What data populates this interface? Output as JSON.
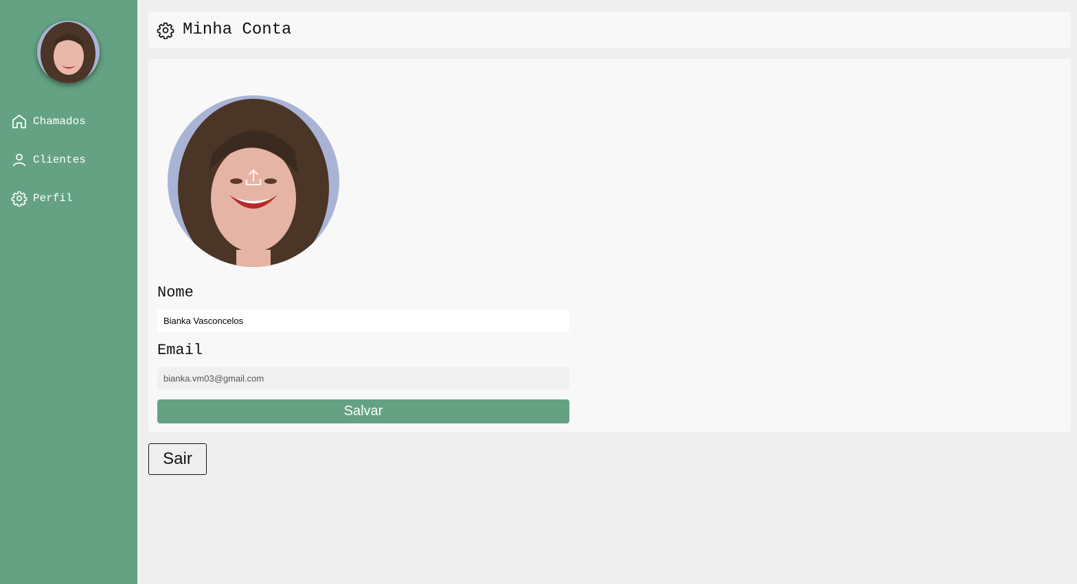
{
  "sidebar": {
    "items": [
      {
        "label": "Chamados",
        "icon": "home-icon"
      },
      {
        "label": "Clientes",
        "icon": "user-icon"
      },
      {
        "label": "Perfil",
        "icon": "gear-icon"
      }
    ]
  },
  "header": {
    "title": "Minha Conta",
    "icon": "gear-icon"
  },
  "form": {
    "name_label": "Nome",
    "name_value": "Bianka Vasconcelos",
    "email_label": "Email",
    "email_value": "bianka.vm03@gmail.com",
    "save_label": "Salvar"
  },
  "logout_label": "Sair",
  "colors": {
    "accent": "#64a283",
    "panel": "#f8f8f8",
    "background": "#efefef"
  }
}
